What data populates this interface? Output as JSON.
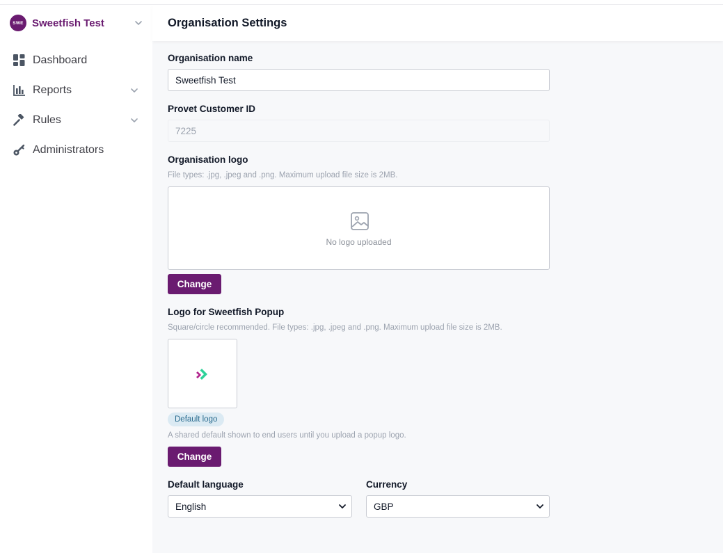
{
  "sidebar": {
    "org": {
      "avatar_text": "SWE",
      "name": "Sweetfish Test"
    },
    "items": [
      {
        "label": "Dashboard",
        "icon": "dashboard-icon",
        "has_children": false
      },
      {
        "label": "Reports",
        "icon": "bar-chart-icon",
        "has_children": true
      },
      {
        "label": "Rules",
        "icon": "gavel-icon",
        "has_children": true
      },
      {
        "label": "Administrators",
        "icon": "key-icon",
        "has_children": false
      }
    ]
  },
  "page": {
    "title": "Organisation Settings"
  },
  "form": {
    "org_name": {
      "label": "Organisation name",
      "value": "Sweetfish Test"
    },
    "customer_id": {
      "label": "Provet Customer ID",
      "value": "7225"
    },
    "org_logo": {
      "label": "Organisation logo",
      "hint": "File types: .jpg, .jpeg and .png. Maximum upload file size is 2MB.",
      "empty_text": "No logo uploaded",
      "button": "Change"
    },
    "popup_logo": {
      "label": "Logo for Sweetfish Popup",
      "hint": "Square/circle recommended. File types: .jpg, .jpeg and .png. Maximum upload file size is 2MB.",
      "badge": "Default logo",
      "note": "A shared default shown to end users until you upload a popup logo.",
      "button": "Change"
    },
    "language": {
      "label": "Default language",
      "value": "English"
    },
    "currency": {
      "label": "Currency",
      "value": "GBP"
    }
  },
  "colors": {
    "brand": "#6a1b70",
    "badge_bg": "#dbeaf3",
    "badge_text": "#2b6c8f",
    "logo_green": "#2fd19a",
    "logo_magenta": "#b0228c"
  }
}
